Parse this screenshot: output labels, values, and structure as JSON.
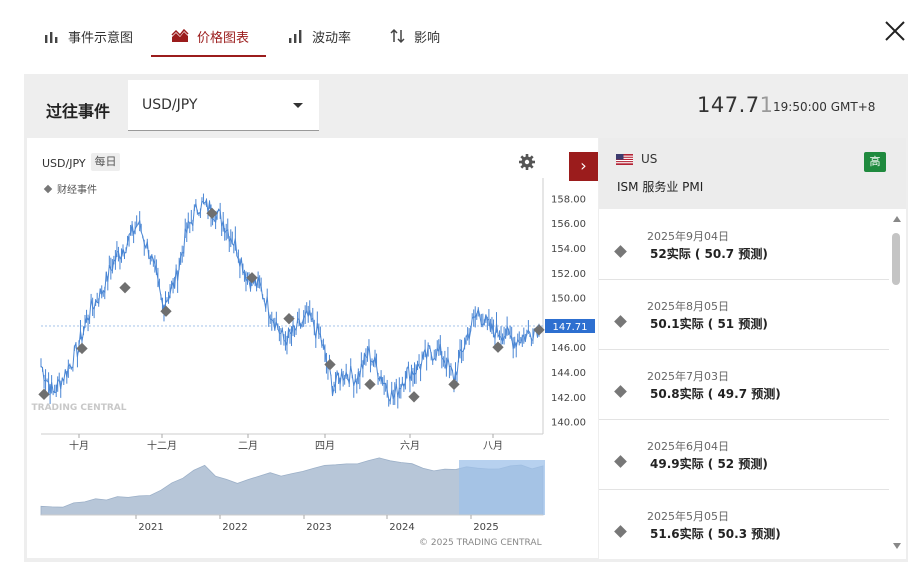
{
  "tabs": [
    {
      "label": "事件示意图",
      "icon": "bar-chart-icon",
      "active": false
    },
    {
      "label": "价格图表",
      "icon": "price-chart-icon",
      "active": true
    },
    {
      "label": "波动率",
      "icon": "volatility-icon",
      "active": false
    },
    {
      "label": "影响",
      "icon": "impact-arrows-icon",
      "active": false
    }
  ],
  "header": {
    "title": "过往事件",
    "pair_select": "USD/JPY",
    "price_main": "147.7",
    "price_last_digit": "1",
    "time": "19:50:00 GMT+8"
  },
  "chart": {
    "symbol": "USD/JPY",
    "interval": "每日",
    "legend": "财经事件",
    "current_price_label": "147.71",
    "copyright": "© 2025 TRADING CENTRAL",
    "watermark": "TRADING CENTRAL",
    "accent_line": "#4a86d4",
    "navigator_fill": "#b7c6d8",
    "navigator_highlight": "#9fc1ea"
  },
  "chart_data": {
    "type": "line",
    "title": "USD/JPY",
    "ylim": [
      139,
      159
    ],
    "y_ticks": [
      "140.00",
      "142.00",
      "144.00",
      "146.00",
      "148.00",
      "150.00",
      "152.00",
      "154.00",
      "156.00",
      "158.00"
    ],
    "x_ticks": [
      "十月",
      "十二月",
      "二月",
      "四月",
      "六月",
      "八月"
    ],
    "series": [
      {
        "values": [
          144.5,
          142.3,
          143.9,
          145.8,
          148.9,
          150.5,
          152.9,
          154.4,
          156.0,
          153.5,
          149.4,
          151.1,
          155.3,
          157.5,
          157.2,
          156.2,
          154.3,
          151.6,
          150.9,
          148.7,
          146.5,
          147.4,
          148.4,
          146.8,
          142.8,
          144.0,
          143.5,
          145.6,
          143.7,
          141.9,
          143.8,
          144.3,
          145.6,
          145.5,
          143.5,
          146.7,
          148.9,
          147.4,
          147.2,
          146.5,
          147.0,
          147.7
        ]
      }
    ],
    "event_markers": [
      {
        "label": "2024-08",
        "y": 142.2
      },
      {
        "label": "2024-09",
        "y": 145.9
      },
      {
        "label": "2024-10",
        "y": 150.8
      },
      {
        "label": "2024-11",
        "y": 148.9
      },
      {
        "label": "2025-01",
        "y": 156.8
      },
      {
        "label": "2025-02",
        "y": 151.6
      },
      {
        "label": "2025-03",
        "y": 148.3
      },
      {
        "label": "2025-04",
        "y": 144.6
      },
      {
        "label": "2025-05a",
        "y": 143.0
      },
      {
        "label": "2025-05b",
        "y": 142.0
      },
      {
        "label": "2025-06",
        "y": 143.0
      },
      {
        "label": "2025-07",
        "y": 146.0
      },
      {
        "label": "2025-08",
        "y": 147.4
      }
    ],
    "navigator": {
      "x_ticks": [
        "2021",
        "2022",
        "2023",
        "2024",
        "2025"
      ],
      "values": [
        104,
        103,
        105,
        108,
        110,
        112,
        113,
        115,
        114,
        116,
        118,
        123,
        130,
        136,
        145,
        148,
        139,
        135,
        131,
        133,
        137,
        141,
        139,
        141,
        144,
        146,
        149,
        151,
        150,
        152,
        155,
        158,
        154,
        153,
        150,
        146,
        143,
        144,
        145,
        147,
        148,
        147,
        146,
        148,
        149,
        147,
        148
      ]
    }
  },
  "event_panel": {
    "country": "US",
    "event": "ISM 服务业 PMI",
    "importance": "高",
    "items": [
      {
        "date": "2025年9月04日",
        "value": "52实际 ( 50.7 预测)"
      },
      {
        "date": "2025年8月05日",
        "value": "50.1实际 ( 51 预测)"
      },
      {
        "date": "2025年7月03日",
        "value": "50.8实际 ( 49.7 预测)"
      },
      {
        "date": "2025年6月04日",
        "value": "49.9实际 ( 52 预测)"
      },
      {
        "date": "2025年5月05日",
        "value": "51.6实际 ( 50.3 预测)"
      }
    ]
  }
}
